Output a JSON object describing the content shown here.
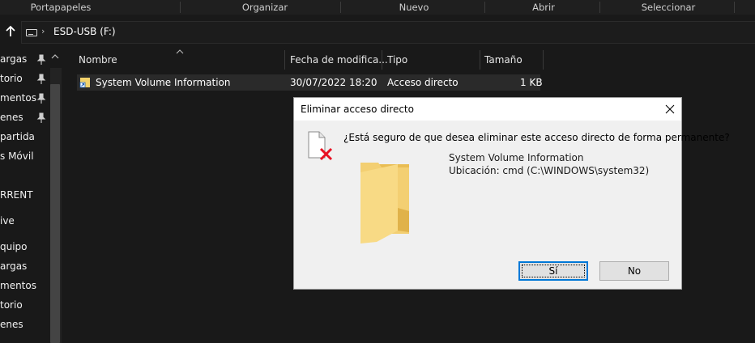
{
  "ribbon": {
    "groups": [
      "Portapapeles",
      "Organizar",
      "Nuevo",
      "Abrir",
      "Seleccionar"
    ]
  },
  "address": {
    "path": "ESD-USB (F:)"
  },
  "nav_pane": {
    "items": [
      {
        "label": "argas",
        "pinned": true
      },
      {
        "label": "torio",
        "pinned": true
      },
      {
        "label": "mentos",
        "pinned": true
      },
      {
        "label": "enes",
        "pinned": true
      },
      {
        "label": "partida",
        "pinned": false
      },
      {
        "label": "s Móvil",
        "pinned": false
      },
      {
        "label": "RRENT",
        "pinned": false
      },
      {
        "label": "ive",
        "pinned": false
      },
      {
        "label": "quipo",
        "pinned": false
      },
      {
        "label": "argas",
        "pinned": false
      },
      {
        "label": "mentos",
        "pinned": false
      },
      {
        "label": "torio",
        "pinned": false
      },
      {
        "label": "enes",
        "pinned": false
      }
    ]
  },
  "file_list": {
    "columns": [
      "Nombre",
      "Fecha de modifica...",
      "Tipo",
      "Tamaño"
    ],
    "rows": [
      {
        "name": "System Volume Information",
        "date": "30/07/2022 18:20",
        "type": "Acceso directo",
        "size": "1 KB"
      }
    ]
  },
  "dialog": {
    "title": "Eliminar acceso directo",
    "question": "¿Está seguro de que desea eliminar este acceso directo de forma permanente?",
    "item_name": "System Volume Information",
    "item_location": "Ubicación: cmd (C:\\WINDOWS\\system32)",
    "yes_label": "Sí",
    "no_label": "No"
  },
  "colors": {
    "background": "#191919",
    "selection": "#2a2a2a",
    "accent": "#0078d7",
    "delete_x": "#e81123",
    "folder": "#f8d775"
  }
}
